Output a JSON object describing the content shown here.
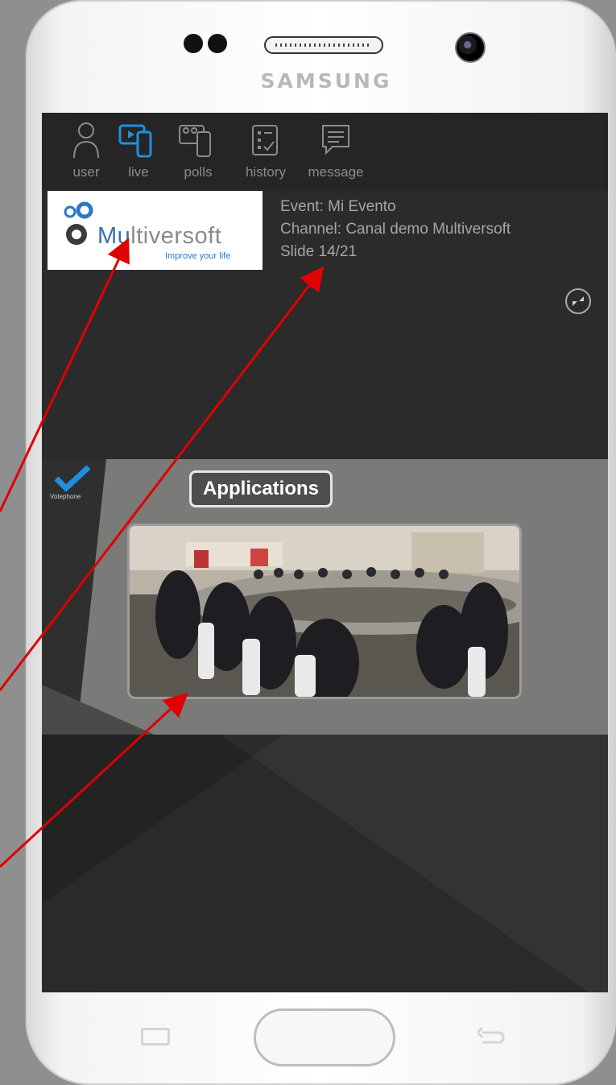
{
  "device": {
    "brand": "SAMSUNG"
  },
  "nav": {
    "items": [
      {
        "id": "user",
        "label": "user",
        "icon": "user-icon"
      },
      {
        "id": "live",
        "label": "live",
        "icon": "live-icon",
        "active": true
      },
      {
        "id": "polls",
        "label": "polls",
        "icon": "polls-icon"
      },
      {
        "id": "history",
        "label": "history",
        "icon": "history-icon"
      },
      {
        "id": "message",
        "label": "message",
        "icon": "message-icon"
      }
    ]
  },
  "logo": {
    "name_prefix": "Mu",
    "name_rest": "ltiversoft",
    "tagline": "Improve your life"
  },
  "event": {
    "event_line": "Event: Mi Evento",
    "channel_line": "Channel: Canal demo Multiversoft",
    "slide_line": "Slide 14/21"
  },
  "slide": {
    "title": "Applications",
    "watermark": "Votephone"
  },
  "colors": {
    "accent": "#1f8fe0",
    "arrow": "#e00000",
    "screen_bg": "#2b2b2b"
  }
}
